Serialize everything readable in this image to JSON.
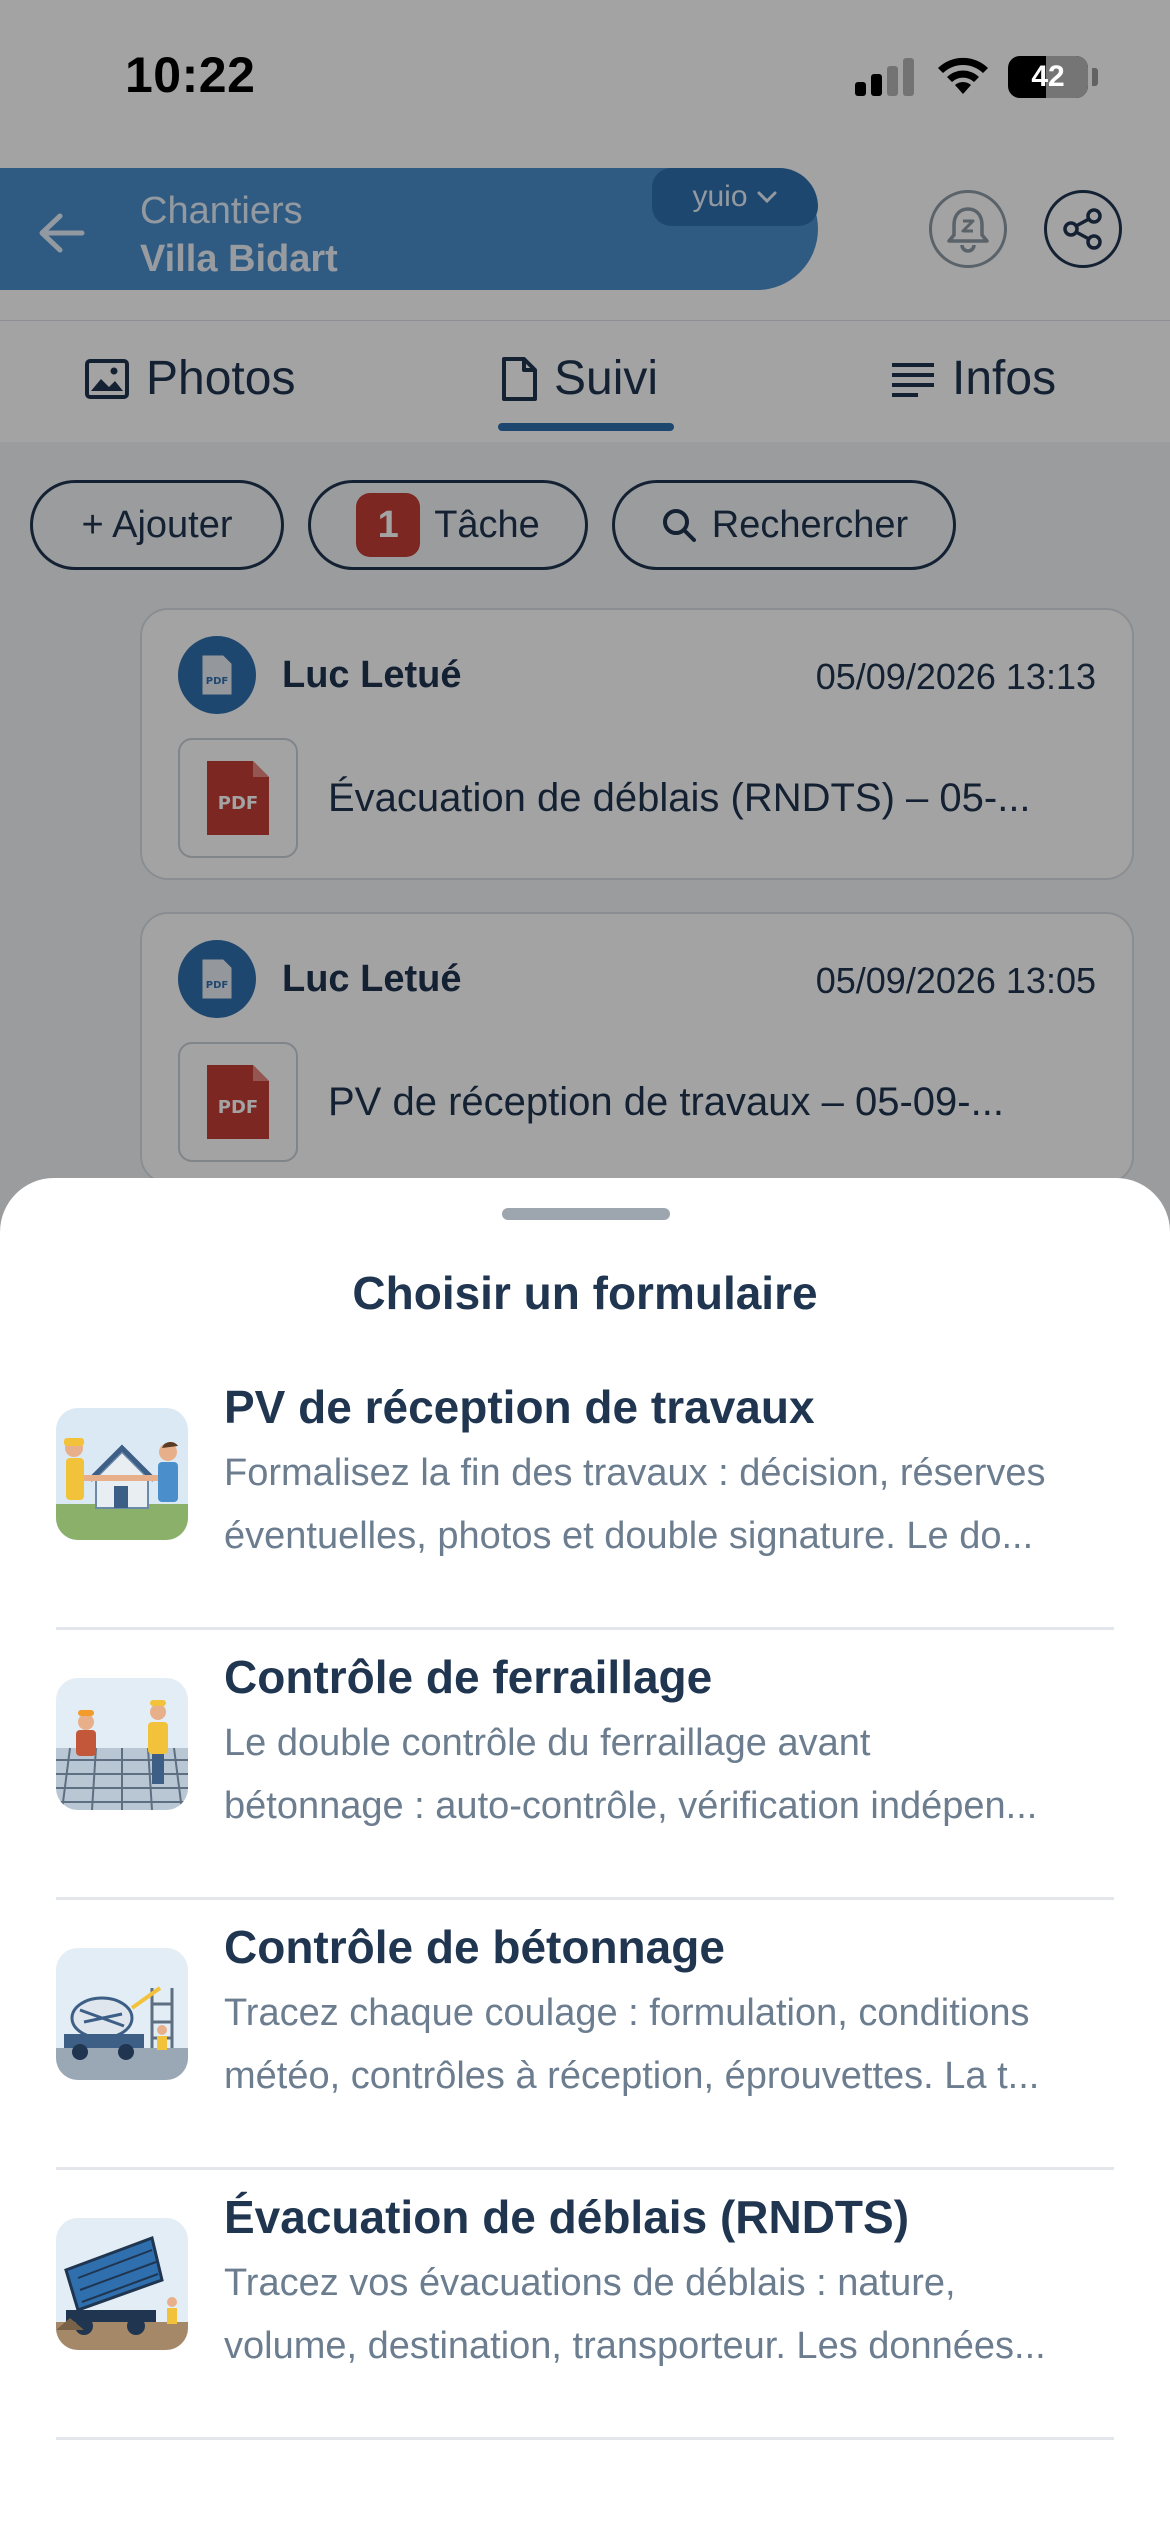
{
  "status_bar": {
    "time": "10:22",
    "battery": "42"
  },
  "header": {
    "breadcrumb_parent": "Chantiers",
    "breadcrumb_current": "Villa Bidart",
    "workspace_selector": "yuio"
  },
  "tabs": [
    {
      "label": "Photos",
      "icon": "image-icon"
    },
    {
      "label": "Suivi",
      "icon": "document-icon",
      "active": true
    },
    {
      "label": "Infos",
      "icon": "lines-icon"
    }
  ],
  "chips": {
    "add_label": "+ Ajouter",
    "task_count": "1",
    "task_label": "Tâche",
    "search_label": "Rechercher"
  },
  "feed": [
    {
      "author": "Luc Letué",
      "date": "05/09/2026 13:13",
      "file": "Évacuation de déblais (RNDTS) – 05-...",
      "file_type": "PDF"
    },
    {
      "author": "Luc Letué",
      "date": "05/09/2026 13:05",
      "file": "PV de réception de travaux – 05-09-...",
      "file_type": "PDF"
    }
  ],
  "sheet": {
    "title": "Choisir un formulaire",
    "forms": [
      {
        "title": "PV de réception de travaux",
        "desc_line1": "Formalisez la fin des travaux : décision, réserves",
        "desc_line2": "éventuelles, photos et double signature. Le do..."
      },
      {
        "title": "Contrôle de ferraillage",
        "desc_line1": "Le double contrôle du ferraillage avant",
        "desc_line2": "bétonnage : auto-contrôle, vérification indépen..."
      },
      {
        "title": "Contrôle de bétonnage",
        "desc_line1": "Tracez chaque coulage : formulation, conditions",
        "desc_line2": "météo, contrôles à réception, éprouvettes. La t..."
      },
      {
        "title": "Évacuation de déblais (RNDTS)",
        "desc_line1": "Tracez vos évacuations de déblais : nature,",
        "desc_line2": "volume, destination, transporteur. Les données..."
      }
    ]
  },
  "colors": {
    "primary": "#2f6fae",
    "breadcrumb_bg": "#4a8fcc",
    "text_dark": "#1f3550",
    "text_muted": "#6b7d8f",
    "badge_red": "#c23d35"
  }
}
